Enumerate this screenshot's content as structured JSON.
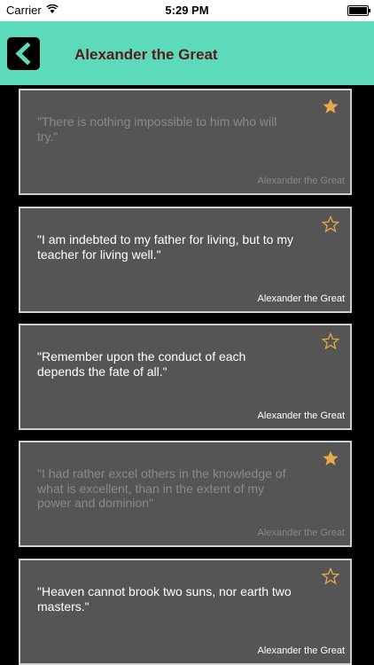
{
  "status_bar": {
    "carrier": "Carrier",
    "time": "5:29 PM"
  },
  "nav": {
    "title": "Alexander the Great",
    "back_icon": "chevron-left-icon"
  },
  "colors": {
    "nav_bg": "#5ddab9",
    "title": "#5a1a1a",
    "card_bg": "#555555",
    "star": "#e8a948"
  },
  "quotes": [
    {
      "text": "\"There is nothing impossible to him who will try.\"",
      "author": "Alexander the Great",
      "favorited": true
    },
    {
      "text": "\"I am indebted to my father for living, but to my teacher for living well.\"",
      "author": "Alexander the Great",
      "favorited": false
    },
    {
      "text": "\"Remember upon the conduct of each depends the fate of all.\"",
      "author": "Alexander the Great",
      "favorited": false
    },
    {
      "text": "\"I had rather excel others in the knowledge of what is excellent, than in the extent of my power and dominion\"",
      "author": "Alexander the Great",
      "favorited": true
    },
    {
      "text": "\"Heaven cannot brook two suns, nor earth two masters.\"",
      "author": "Alexander the Great",
      "favorited": false
    }
  ]
}
